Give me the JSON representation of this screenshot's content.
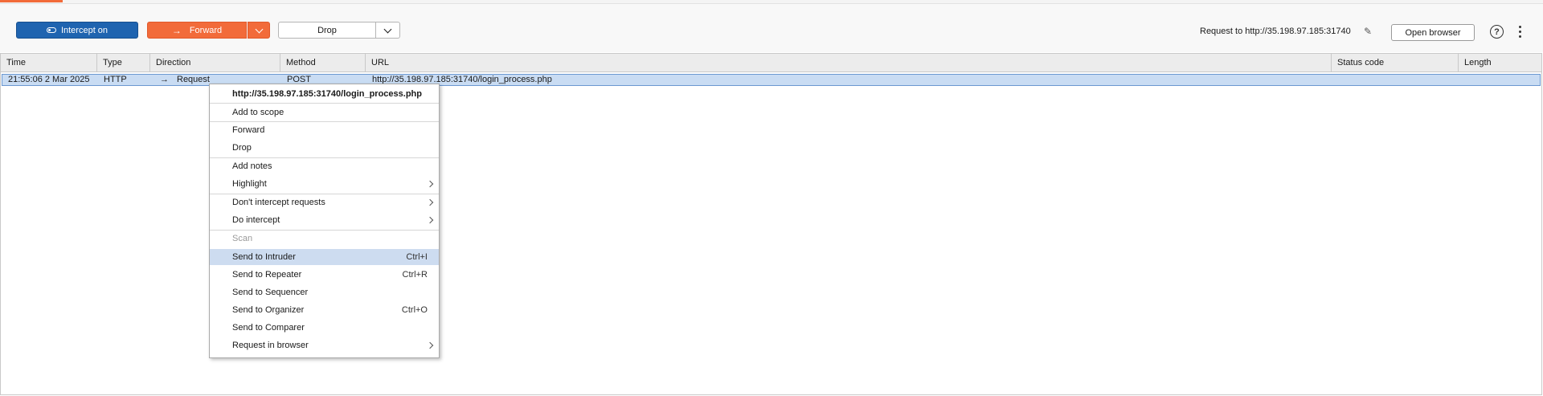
{
  "toolbar": {
    "intercept_label": "Intercept on",
    "forward_label": "Forward",
    "drop_label": "Drop",
    "request_target": "Request to http://35.198.97.185:31740",
    "open_browser_label": "Open browser",
    "help_glyph": "?"
  },
  "table": {
    "columns": [
      "Time",
      "Type",
      "Direction",
      "Method",
      "URL",
      "Status code",
      "Length"
    ],
    "rows": [
      {
        "time": "21:55:06 2 Mar 2025",
        "type": "HTTP",
        "direction": "Request",
        "method": "POST",
        "url": "http://35.198.97.185:31740/login_process.php",
        "status": "",
        "length": ""
      }
    ]
  },
  "context_menu": {
    "header": "http://35.198.97.185:31740/login_process.php",
    "items": [
      {
        "label": "Add to scope"
      },
      {
        "label": "Forward"
      },
      {
        "label": "Drop"
      },
      {
        "label": "Add notes"
      },
      {
        "label": "Highlight"
      },
      {
        "label": "Don't intercept requests"
      },
      {
        "label": "Do intercept"
      },
      {
        "label": "Scan"
      },
      {
        "label": "Send to Intruder",
        "shortcut": "Ctrl+I"
      },
      {
        "label": "Send to Repeater",
        "shortcut": "Ctrl+R"
      },
      {
        "label": "Send to Sequencer"
      },
      {
        "label": "Send to Organizer",
        "shortcut": "Ctrl+O"
      },
      {
        "label": "Send to Comparer"
      },
      {
        "label": "Request in browser"
      }
    ]
  },
  "colors": {
    "intercept_blue": "#1f64b0",
    "forward_orange": "#f26b3a",
    "row_selected": "#c9dcf3",
    "menu_hover": "#cddcf0"
  }
}
